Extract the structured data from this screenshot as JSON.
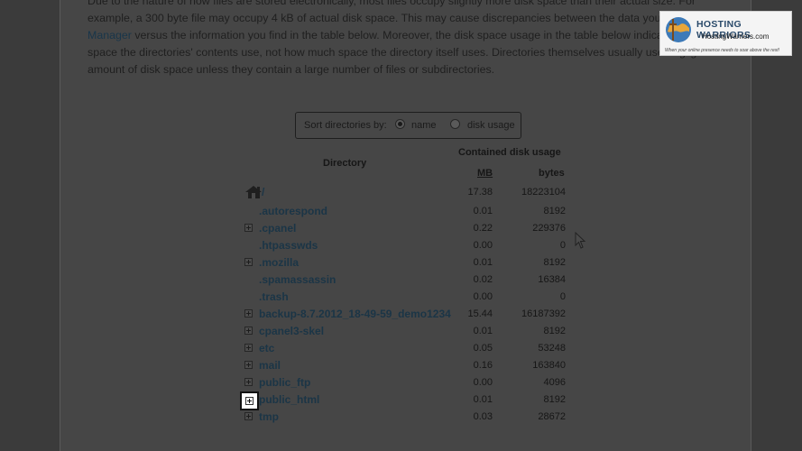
{
  "intro": {
    "line1": "Due to the nature of how files are stored electronically, most files occupy slightly more disk space than their actual size. For",
    "line2": "example, a 300 byte file may occupy 4 kB of actual disk space. This may cause discrepancies between the data you see in the File",
    "link": "Manager",
    "line3": " versus the information you find in the table below. Moreover, the disk space usage in the table below indicates how much",
    "line4": "space the directories' contents use, not how much space the directory itself uses. Directories themselves usually use negligible",
    "line5": "amount of disk space unless they contain a large number of files or subdirectories."
  },
  "sort": {
    "label": "Sort directories by:",
    "options": [
      "name",
      "disk usage"
    ],
    "selected": "name"
  },
  "table": {
    "directory_header": "Directory",
    "contained_header": "Contained disk usage",
    "mb_header": "MB",
    "bytes_header": "bytes",
    "root": {
      "name": "/",
      "mb": "17.38",
      "bytes": "18223104"
    },
    "rows": [
      {
        "name": ".autorespond",
        "mb": "0.01",
        "bytes": "8192",
        "expandable": false
      },
      {
        "name": ".cpanel",
        "mb": "0.22",
        "bytes": "229376",
        "expandable": true
      },
      {
        "name": ".htpasswds",
        "mb": "0.00",
        "bytes": "0",
        "expandable": false
      },
      {
        "name": ".mozilla",
        "mb": "0.01",
        "bytes": "8192",
        "expandable": true
      },
      {
        "name": ".spamassassin",
        "mb": "0.02",
        "bytes": "16384",
        "expandable": false
      },
      {
        "name": ".trash",
        "mb": "0.00",
        "bytes": "0",
        "expandable": false
      },
      {
        "name": "backup-8.7.2012_18-49-59_demo1234",
        "mb": "15.44",
        "bytes": "16187392",
        "expandable": true
      },
      {
        "name": "cpanel3-skel",
        "mb": "0.01",
        "bytes": "8192",
        "expandable": true
      },
      {
        "name": "etc",
        "mb": "0.05",
        "bytes": "53248",
        "expandable": true
      },
      {
        "name": "mail",
        "mb": "0.16",
        "bytes": "163840",
        "expandable": true
      },
      {
        "name": "public_ftp",
        "mb": "0.00",
        "bytes": "4096",
        "expandable": true
      },
      {
        "name": "public_html",
        "mb": "0.01",
        "bytes": "8192",
        "expandable": true
      },
      {
        "name": "tmp",
        "mb": "0.03",
        "bytes": "28672",
        "expandable": true
      }
    ]
  },
  "watermark": {
    "title": "HOSTING WARRIORS",
    "url": "HostingWarriors.com",
    "tagline": "When your online presence needs to soar above the rest!"
  }
}
